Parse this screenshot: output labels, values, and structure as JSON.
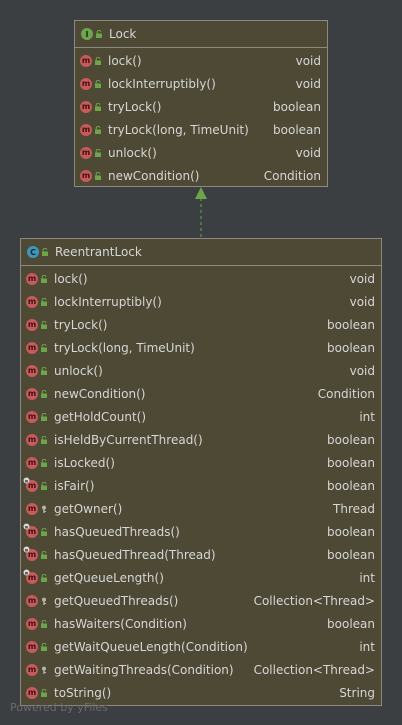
{
  "interface_node": {
    "kind": "I",
    "title": "Lock",
    "methods": [
      {
        "name": "lock()",
        "type": "void",
        "vis": "public"
      },
      {
        "name": "lockInterruptibly()",
        "type": "void",
        "vis": "public"
      },
      {
        "name": "tryLock()",
        "type": "boolean",
        "vis": "public"
      },
      {
        "name": "tryLock(long, TimeUnit)",
        "type": "boolean",
        "vis": "public"
      },
      {
        "name": "unlock()",
        "type": "void",
        "vis": "public"
      },
      {
        "name": "newCondition()",
        "type": "Condition",
        "vis": "public"
      }
    ]
  },
  "class_node": {
    "kind": "C",
    "title": "ReentrantLock",
    "methods": [
      {
        "name": "lock()",
        "type": "void",
        "vis": "public"
      },
      {
        "name": "lockInterruptibly()",
        "type": "void",
        "vis": "public"
      },
      {
        "name": "tryLock()",
        "type": "boolean",
        "vis": "public"
      },
      {
        "name": "tryLock(long, TimeUnit)",
        "type": "boolean",
        "vis": "public"
      },
      {
        "name": "unlock()",
        "type": "void",
        "vis": "public"
      },
      {
        "name": "newCondition()",
        "type": "Condition",
        "vis": "public"
      },
      {
        "name": "getHoldCount()",
        "type": "int",
        "vis": "public"
      },
      {
        "name": "isHeldByCurrentThread()",
        "type": "boolean",
        "vis": "public"
      },
      {
        "name": "isLocked()",
        "type": "boolean",
        "vis": "public"
      },
      {
        "name": "isFair()",
        "type": "boolean",
        "vis": "public",
        "final": true
      },
      {
        "name": "getOwner()",
        "type": "Thread",
        "vis": "protected"
      },
      {
        "name": "hasQueuedThreads()",
        "type": "boolean",
        "vis": "public",
        "final": true
      },
      {
        "name": "hasQueuedThread(Thread)",
        "type": "boolean",
        "vis": "public",
        "final": true
      },
      {
        "name": "getQueueLength()",
        "type": "int",
        "vis": "public",
        "final": true
      },
      {
        "name": "getQueuedThreads()",
        "type": "Collection<Thread>",
        "vis": "protected"
      },
      {
        "name": "hasWaiters(Condition)",
        "type": "boolean",
        "vis": "public"
      },
      {
        "name": "getWaitQueueLength(Condition)",
        "type": "int",
        "vis": "public"
      },
      {
        "name": "getWaitingThreads(Condition)",
        "type": "Collection<Thread>",
        "vis": "protected"
      },
      {
        "name": "toString()",
        "type": "String",
        "vis": "public"
      }
    ]
  },
  "edge": {
    "kind": "implements",
    "from": "ReentrantLock",
    "to": "Lock"
  },
  "colors": {
    "background": "#3c3f41",
    "node_fill": "#4e4935",
    "node_border": "#8c8a80",
    "method_icon": "#c75a5a",
    "public_icon": "#6da54a",
    "protected_icon": "#d8a94a",
    "edge": "#6da54a"
  },
  "icons": {
    "method": "m-method-icon",
    "public": "unlocked-padlock-icon",
    "protected": "key-icon",
    "interface": "interface-icon",
    "class": "class-icon"
  },
  "footer": {
    "text": "Powered by yFiles"
  }
}
